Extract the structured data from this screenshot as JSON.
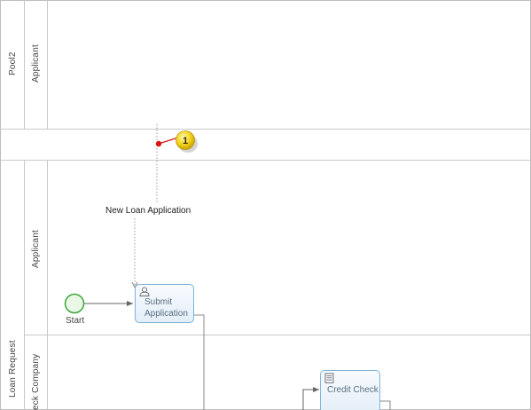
{
  "pools": {
    "pool2": {
      "name": "Pool2",
      "lane": "Applicant"
    },
    "loan_request": {
      "name": "Loan Request",
      "lanes": [
        "Applicant",
        "eck Company"
      ]
    }
  },
  "elements": {
    "start_event": {
      "label": "Start"
    },
    "submit_task": {
      "line1": "Submit",
      "line2": "Application"
    },
    "credit_task": {
      "label": "Credit Check"
    },
    "message_flow": {
      "label": "New Loan Application"
    },
    "marker": {
      "number": "1"
    }
  },
  "colors": {
    "lane_border": "#c9c9c9",
    "task_border": "#7eb3da",
    "start_event": "#3aa63a",
    "marker_dot": "#e01010",
    "marker_badge": "#f3d21a"
  }
}
